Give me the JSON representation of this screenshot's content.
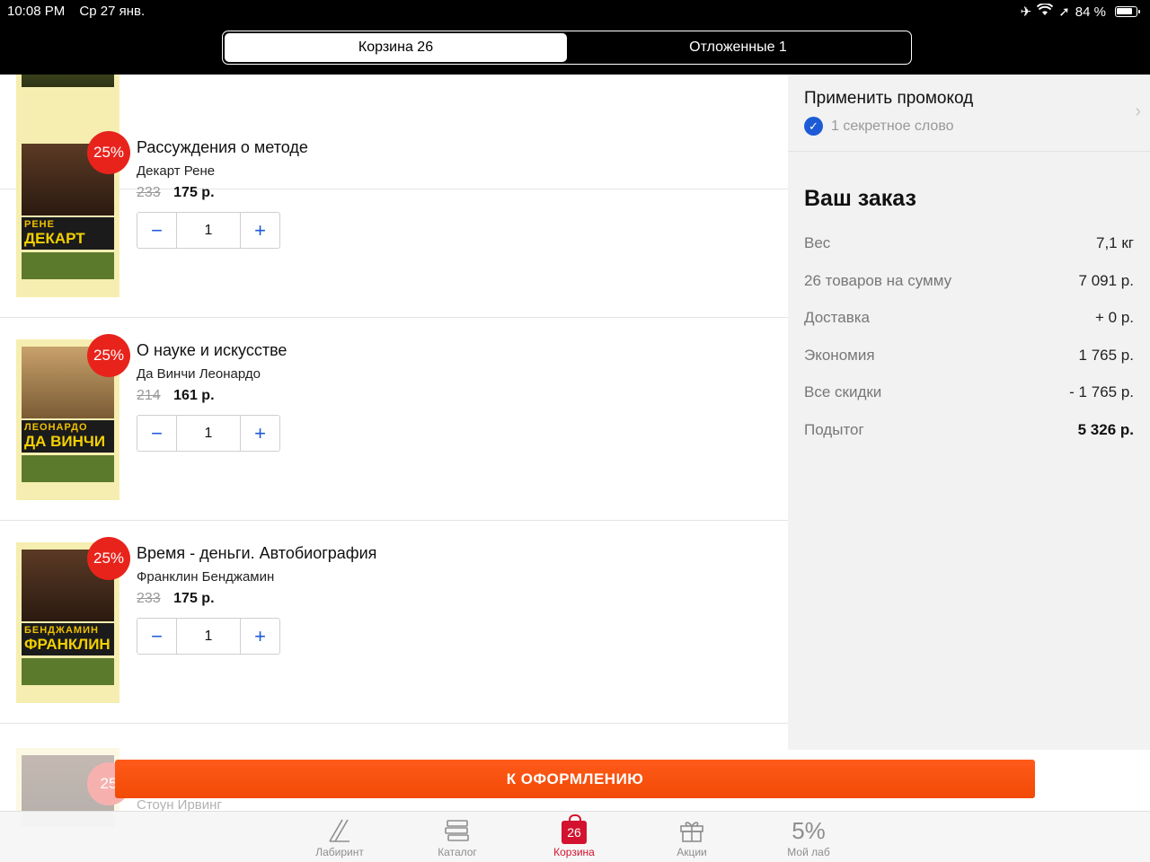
{
  "status_bar": {
    "time": "10:08 PM",
    "date": "Ср 27 янв.",
    "battery": "84 %"
  },
  "segments": {
    "cart": "Корзина 26",
    "deferred": "Отложенные 1"
  },
  "items": [
    {
      "title": "Рассуждения о методе",
      "author": "Декарт Рене",
      "old_price": "233",
      "price": "175 р.",
      "discount": "25%",
      "qty": "1",
      "cover_first": "РЕНЕ",
      "cover_last": "ДЕКАРТ"
    },
    {
      "title": "О науке и искусстве",
      "author": "Да Винчи Леонардо",
      "old_price": "214",
      "price": "161 р.",
      "discount": "25%",
      "qty": "1",
      "cover_first": "ЛЕОНАРДО",
      "cover_last": "ДА ВИНЧИ"
    },
    {
      "title": "Время - деньги. Автобиография",
      "author": "Франклин Бенджамин",
      "old_price": "233",
      "price": "175 р.",
      "discount": "25%",
      "qty": "1",
      "cover_first": "БЕНДЖАМИН",
      "cover_last": "ФРАНКЛИН"
    }
  ],
  "partial_item": {
    "discount": "25",
    "author": "Стоун Ирвинг"
  },
  "promo": {
    "title": "Применить промокод",
    "applied": "1 секретное слово"
  },
  "order": {
    "title": "Ваш заказ",
    "rows": [
      {
        "label": "Вес",
        "value": "7,1 кг"
      },
      {
        "label": "26 товаров на сумму",
        "value": "7 091 р."
      },
      {
        "label": "Доставка",
        "value": "+ 0 р."
      },
      {
        "label": "Экономия",
        "value": "1 765 р."
      },
      {
        "label": "Все скидки",
        "value": "- 1 765 р."
      },
      {
        "label": "Подытог",
        "value": "5 326 р."
      }
    ]
  },
  "checkout_label": "К ОФОРМЛЕНИЮ",
  "tabs": [
    {
      "label": "Лабиринт",
      "icon": "labirint-logo-icon"
    },
    {
      "label": "Каталог",
      "icon": "books-stack-icon"
    },
    {
      "label": "Корзина",
      "icon": "shopping-bag-icon",
      "badge": "26",
      "active": true
    },
    {
      "label": "Акции",
      "icon": "gift-icon"
    },
    {
      "label": "Мой лаб",
      "icon": "percent-text",
      "glyph": "5%"
    }
  ],
  "colors": {
    "accent_red": "#d2122e",
    "discount_red": "#e8231c",
    "checkout_orange": "#f24a06",
    "link_blue": "#1d5bd6"
  }
}
